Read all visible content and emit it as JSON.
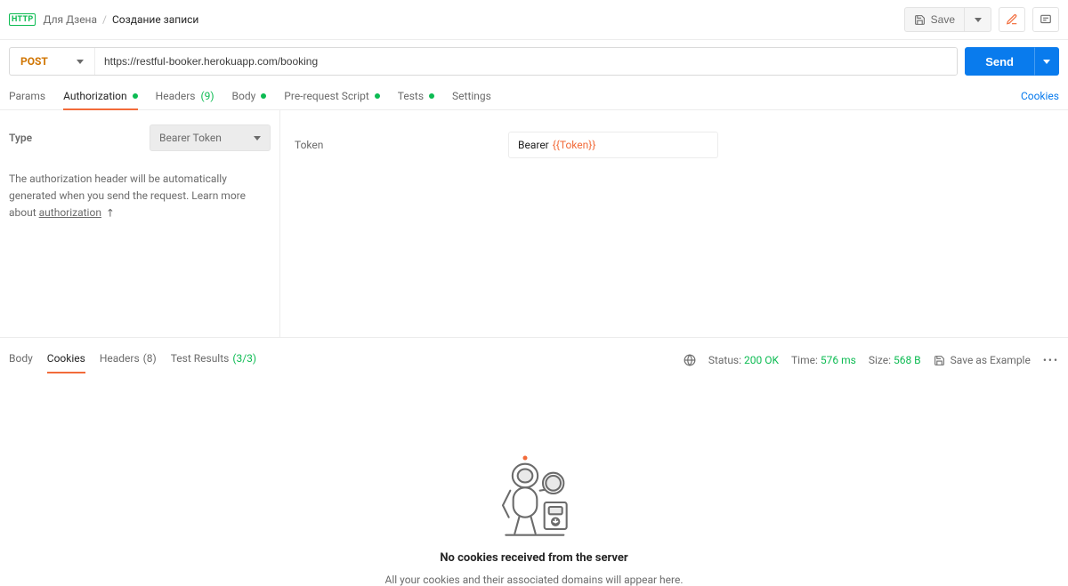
{
  "topbar": {
    "http_badge": "HTTP",
    "breadcrumb_parent": "Для Дзена",
    "breadcrumb_current": "Создание записи",
    "save_label": "Save"
  },
  "request": {
    "method": "POST",
    "url": "https://restful-booker.herokuapp.com/booking",
    "send_label": "Send"
  },
  "tabs": {
    "params": "Params",
    "authorization": "Authorization",
    "headers": "Headers",
    "headers_count": "(9)",
    "body": "Body",
    "prerequest": "Pre-request Script",
    "tests": "Tests",
    "settings": "Settings",
    "cookies_link": "Cookies"
  },
  "auth": {
    "type_label": "Type",
    "type_value": "Bearer Token",
    "help_text_1": "The authorization header will be automatically generated when you send the request. Learn more about ",
    "help_link_label": "authorization",
    "token_label": "Token",
    "token_prefix": "Bearer",
    "token_var": "{{Token}}"
  },
  "response": {
    "tabs": {
      "body": "Body",
      "cookies": "Cookies",
      "headers": "Headers",
      "headers_count": "(8)",
      "test_results": "Test Results",
      "test_results_count": "(3/3)"
    },
    "meta": {
      "status_label": "Status:",
      "status_value": "200 OK",
      "time_label": "Time:",
      "time_value": "576 ms",
      "size_label": "Size:",
      "size_value": "568 B"
    },
    "save_example": "Save as Example",
    "empty_title": "No cookies received from the server",
    "empty_sub": "All your cookies and their associated domains will appear here."
  }
}
